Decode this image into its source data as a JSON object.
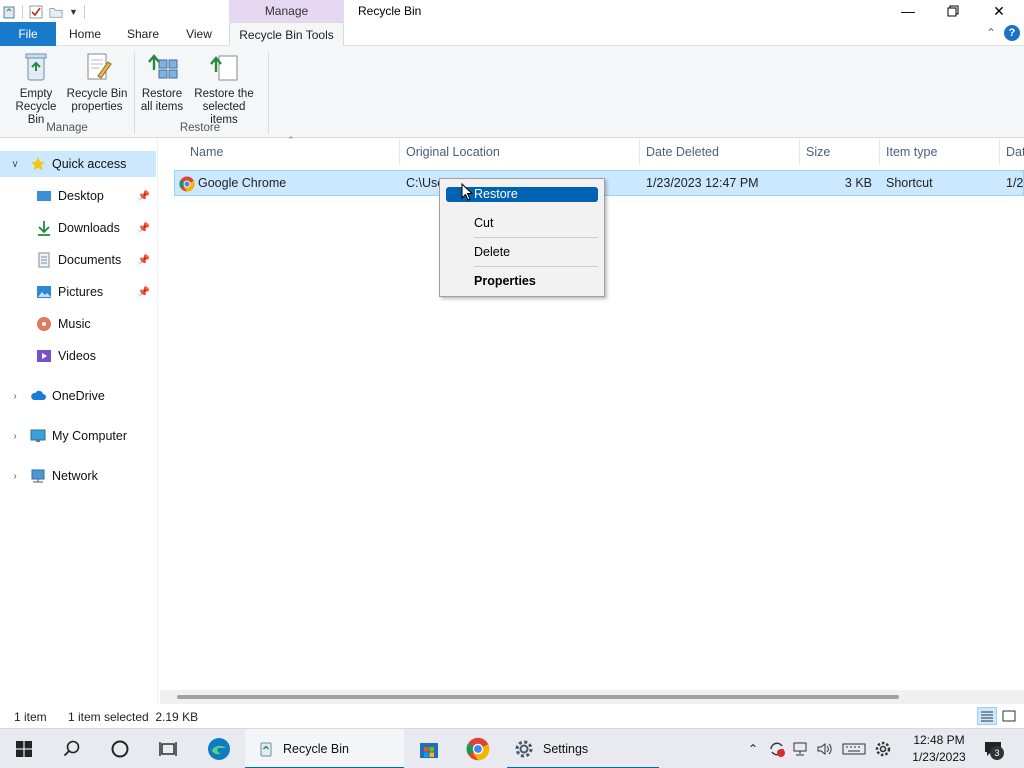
{
  "window": {
    "title": "Recycle Bin",
    "contextual_tab_group": "Manage"
  },
  "ribbon_tabs": [
    {
      "label": "File"
    },
    {
      "label": "Home"
    },
    {
      "label": "Share"
    },
    {
      "label": "View"
    },
    {
      "label": "Recycle Bin Tools"
    }
  ],
  "ribbon": {
    "buttons": [
      {
        "label_line1": "Empty",
        "label_line2": "Recycle Bin",
        "icon": "empty-recycle-bin-icon"
      },
      {
        "label_line1": "Recycle Bin",
        "label_line2": "properties",
        "icon": "recycle-bin-properties-icon"
      },
      {
        "label_line1": "Restore",
        "label_line2": "all items",
        "icon": "restore-all-icon"
      },
      {
        "label_line1": "Restore the",
        "label_line2": "selected items",
        "icon": "restore-selected-icon"
      }
    ],
    "groups": [
      {
        "label": "Manage"
      },
      {
        "label": "Restore"
      }
    ]
  },
  "nav": {
    "items": [
      {
        "label": "Quick access",
        "icon": "star-icon"
      },
      {
        "label": "Desktop",
        "icon": "desktop-icon"
      },
      {
        "label": "Downloads",
        "icon": "download-arrow-icon"
      },
      {
        "label": "Documents",
        "icon": "documents-icon"
      },
      {
        "label": "Pictures",
        "icon": "pictures-icon"
      },
      {
        "label": "Music",
        "icon": "music-icon"
      },
      {
        "label": "Videos",
        "icon": "videos-icon"
      },
      {
        "label": "OneDrive",
        "icon": "cloud-icon"
      },
      {
        "label": "My Computer",
        "icon": "computer-icon"
      },
      {
        "label": "Network",
        "icon": "network-icon"
      }
    ]
  },
  "columns": [
    {
      "label": "Name"
    },
    {
      "label": "Original Location"
    },
    {
      "label": "Date Deleted"
    },
    {
      "label": "Size"
    },
    {
      "label": "Item type"
    },
    {
      "label": "Dat"
    }
  ],
  "files": [
    {
      "name": "Google Chrome",
      "original_location": "C:\\Use",
      "date_deleted": "1/23/2023 12:47 PM",
      "size": "3 KB",
      "item_type": "Shortcut",
      "date_extra": "1/2"
    }
  ],
  "context_menu": {
    "items": [
      {
        "label": "Restore"
      },
      {
        "label": "Cut"
      },
      {
        "label": "Delete"
      },
      {
        "label": "Properties"
      }
    ]
  },
  "status": {
    "item_count": "1 item",
    "selection": "1 item selected  2.19 KB"
  },
  "taskbar": {
    "recycle_bin_label": "Recycle Bin",
    "settings_label": "Settings",
    "time": "12:48 PM",
    "date": "1/23/2023",
    "notification_count": "3"
  },
  "colors": {
    "accent": "#1979ca",
    "selection": "#cce8ff",
    "menu_highlight": "#0063b1",
    "contextual_tab": "#e6d7f2"
  }
}
